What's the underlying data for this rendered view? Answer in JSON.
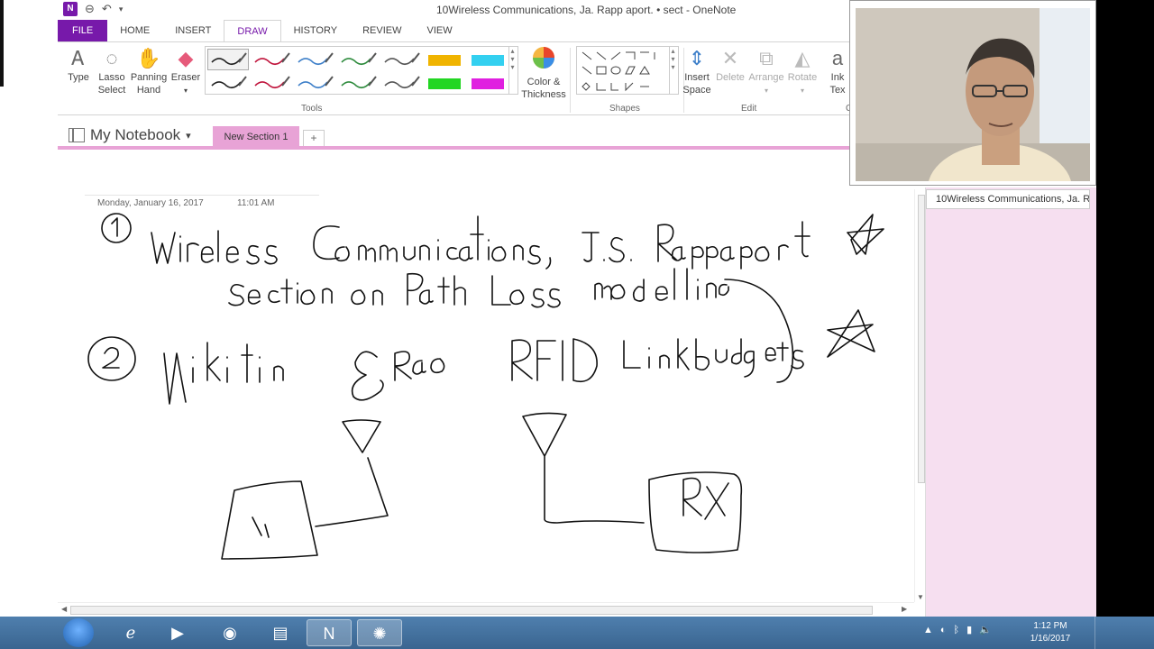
{
  "window": {
    "title": "10Wireless Communications, Ja. Rapp aport. • sect - OneNote",
    "app_logo": "N",
    "qat_icons": [
      "back-icon",
      "undo-icon",
      "customize-icon"
    ]
  },
  "tabs": [
    "FILE",
    "HOME",
    "INSERT",
    "DRAW",
    "HISTORY",
    "REVIEW",
    "VIEW"
  ],
  "active_tab": "DRAW",
  "ribbon": {
    "type": "Type",
    "lasso": [
      "Lasso",
      "Select"
    ],
    "panning": [
      "Panning",
      "Hand"
    ],
    "eraser": "Eraser",
    "color_thickness": [
      "Color &",
      "Thickness"
    ],
    "insert_space": [
      "Insert",
      "Space"
    ],
    "delete": "Delete",
    "arrange": "Arrange",
    "rotate": "Rotate",
    "ink_to_text": [
      "Ink",
      "Tex"
    ],
    "groups": {
      "tools": "Tools",
      "shapes": "Shapes",
      "edit": "Edit",
      "convert": "C"
    },
    "pen_colors": [
      "#222222",
      "#c0143c",
      "#3d7fc9",
      "#2e8b3d",
      "#555555",
      "#f0b400",
      "#33d0f0",
      "#222222",
      "#c0143c",
      "#3d7fc9",
      "#2e8b3d",
      "#555555",
      "#22d622",
      "#e020e0"
    ]
  },
  "notebook": {
    "name": "My Notebook",
    "section": "New Section 1",
    "add_section": "+"
  },
  "page": {
    "date": "Monday, January 16, 2017",
    "time": "11:01 AM"
  },
  "page_list": [
    "10Wireless Communications, Ja. R"
  ],
  "taskbar": {
    "apps": [
      "start-orb",
      "internet-explorer",
      "media-player",
      "firefox",
      "file-explorer",
      "onenote",
      "paint"
    ],
    "clock_time": "1:12 PM",
    "clock_date": "1/16/2017"
  }
}
